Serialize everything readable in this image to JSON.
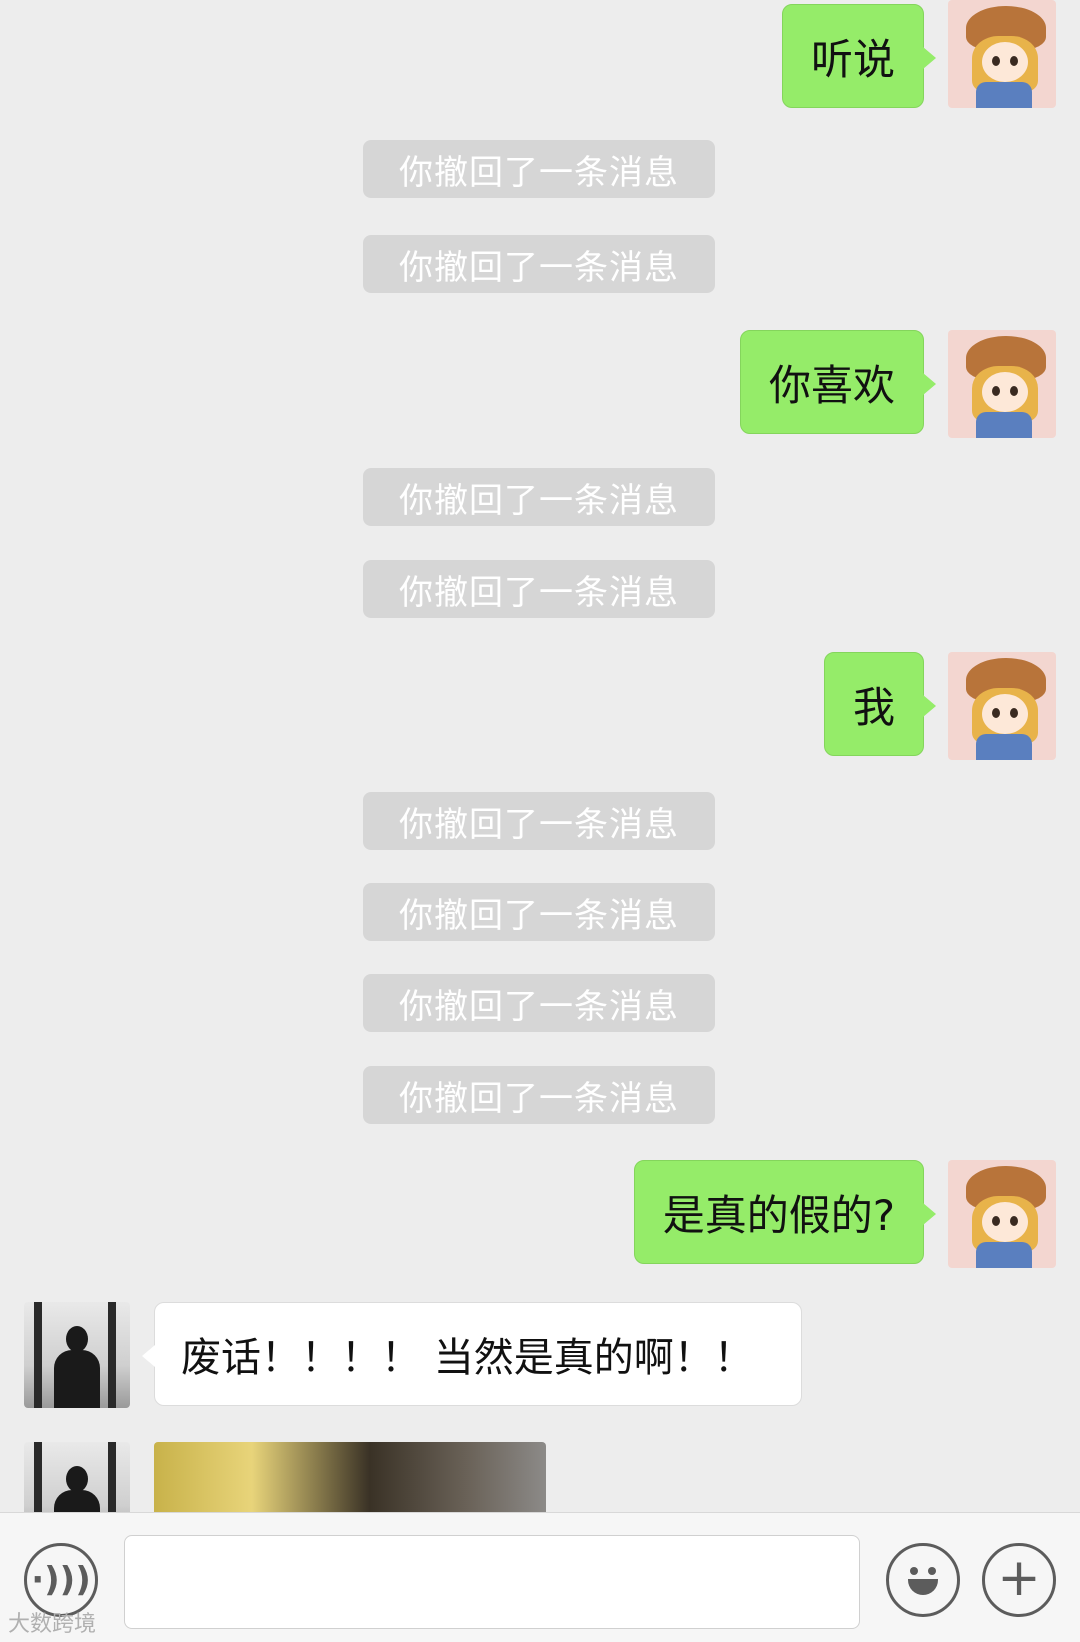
{
  "messages": {
    "sent_1": "听说",
    "sent_2": "你喜欢",
    "sent_3": "我",
    "sent_4": "是真的假的?",
    "received_1": "废话！！！！ 当然是真的啊！！"
  },
  "recall_notice": "你撤回了一条消息",
  "watermark": "大数跨境",
  "colors": {
    "background": "#ededed",
    "sent_bubble": "#95ec69",
    "received_bubble": "#ffffff",
    "recall_notice_bg": "#d6d6d6"
  },
  "icons": [
    "voice-icon",
    "emoji-icon",
    "plus-icon"
  ]
}
